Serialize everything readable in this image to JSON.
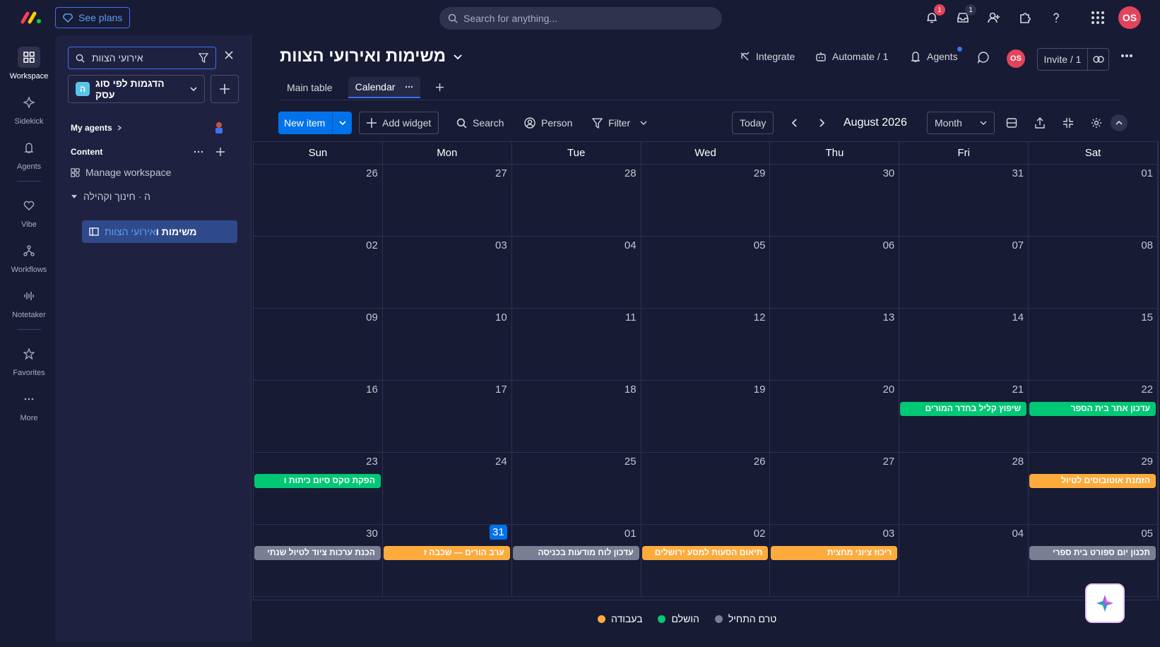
{
  "topbar": {
    "see_plans": "See plans",
    "search_placeholder": "Search for anything...",
    "notifications_count": "1",
    "inbox_count": "1",
    "avatar": "OS"
  },
  "rail": {
    "items": [
      {
        "label": "Workspace",
        "icon": "grid-icon"
      },
      {
        "label": "Sidekick",
        "icon": "sparkle-icon"
      },
      {
        "label": "Agents",
        "icon": "agent-icon"
      },
      {
        "label": "Vibe",
        "icon": "heart-icon"
      },
      {
        "label": "Workflows",
        "icon": "workflow-icon"
      },
      {
        "label": "Notetaker",
        "icon": "waveform-icon"
      },
      {
        "label": "Favorites",
        "icon": "star-icon"
      },
      {
        "label": "More",
        "icon": "dots-icon"
      }
    ]
  },
  "sidebar": {
    "search_value": "אירועי הצוות",
    "workspace_name": "הדגמות לפי סוג עסק",
    "workspace_badge": "ה",
    "my_agents": "My agents",
    "content": "Content",
    "manage_workspace": "Manage workspace",
    "folder": "ה · חינוך וקהילה",
    "board_name_prefix": "משימות ו",
    "board_name_highlight": "אירועי הצוות"
  },
  "board": {
    "title": "משימות ואירועי הצוות",
    "integrate": "Integrate",
    "automate": "Automate / 1",
    "agents": "Agents",
    "avatar": "OS",
    "invite": "Invite / 1",
    "tabs": {
      "main_table": "Main table",
      "calendar": "Calendar"
    }
  },
  "toolbar": {
    "new_item": "New item",
    "add_widget": "Add widget",
    "search": "Search",
    "person": "Person",
    "filter": "Filter",
    "today": "Today",
    "month_label": "August 2026",
    "view": "Month"
  },
  "calendar": {
    "weekdays": [
      "Sun",
      "Mon",
      "Tue",
      "Wed",
      "Thu",
      "Fri",
      "Sat"
    ],
    "weeks": [
      [
        {
          "d": "26"
        },
        {
          "d": "27"
        },
        {
          "d": "28"
        },
        {
          "d": "29"
        },
        {
          "d": "30"
        },
        {
          "d": "31"
        },
        {
          "d": "01"
        }
      ],
      [
        {
          "d": "02"
        },
        {
          "d": "03"
        },
        {
          "d": "04"
        },
        {
          "d": "05"
        },
        {
          "d": "06"
        },
        {
          "d": "07"
        },
        {
          "d": "08"
        }
      ],
      [
        {
          "d": "09"
        },
        {
          "d": "10"
        },
        {
          "d": "11"
        },
        {
          "d": "12"
        },
        {
          "d": "13"
        },
        {
          "d": "14"
        },
        {
          "d": "15"
        }
      ],
      [
        {
          "d": "16"
        },
        {
          "d": "17"
        },
        {
          "d": "18"
        },
        {
          "d": "19"
        },
        {
          "d": "20"
        },
        {
          "d": "21",
          "event": "שיפוץ קליל בחדר המורים",
          "status": "green"
        },
        {
          "d": "22",
          "event": "עדכון אתר בית הספר",
          "status": "green"
        }
      ],
      [
        {
          "d": "23",
          "event": "הפקת טקס סיום כיתות ו",
          "status": "green"
        },
        {
          "d": "24"
        },
        {
          "d": "25"
        },
        {
          "d": "26"
        },
        {
          "d": "27"
        },
        {
          "d": "28"
        },
        {
          "d": "29",
          "event": "הזמנת אוטובוסים לטיול",
          "status": "orange"
        }
      ],
      [
        {
          "d": "30",
          "event": "הכנת ערכות ציוד לטיול שנתי",
          "status": "grey"
        },
        {
          "d": "31",
          "today": true,
          "event": "ערב הורים — שכבה ז",
          "status": "orange"
        },
        {
          "d": "01",
          "event": "עדכון לוח מודעות בכניסה",
          "status": "grey"
        },
        {
          "d": "02",
          "event": "תיאום הסעות למסע ירושלים",
          "status": "orange"
        },
        {
          "d": "03",
          "event": "ריכוז ציוני מחצית",
          "status": "orange"
        },
        {
          "d": "04"
        },
        {
          "d": "05",
          "event": "תכנון יום ספורט בית ספרי",
          "status": "grey"
        }
      ]
    ]
  },
  "legend": [
    {
      "label": "בעבודה",
      "color": "#fdab3d"
    },
    {
      "label": "הושלם",
      "color": "#00c875"
    },
    {
      "label": "טרם התחיל",
      "color": "#797e93"
    }
  ]
}
